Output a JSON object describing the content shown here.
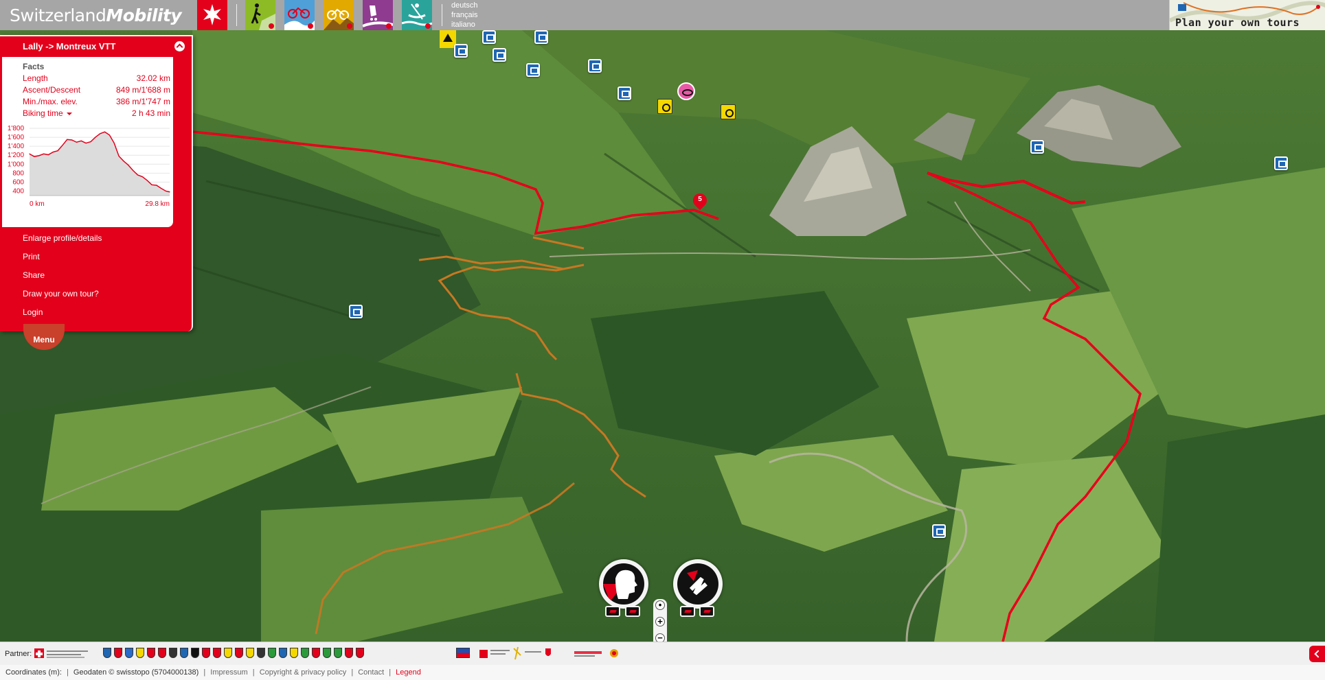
{
  "header": {
    "logo_regular": "Switzerland",
    "logo_bold": "Mobility",
    "languages": [
      "deutsch",
      "français",
      "italiano"
    ],
    "plan_tours_label": "Plan your own tours",
    "activities": [
      {
        "icon": "hiking-icon",
        "color": "#8dbb25"
      },
      {
        "icon": "cycling-icon",
        "color": "#4fa0d8"
      },
      {
        "icon": "mountainbike-icon",
        "color": "#e2a900"
      },
      {
        "icon": "skating-icon",
        "color": "#8f3b8f"
      },
      {
        "icon": "canoeing-icon",
        "color": "#2aa39b"
      }
    ]
  },
  "route_panel": {
    "title": "Lally -> Montreux VTT",
    "facts_heading": "Facts",
    "facts": [
      {
        "label": "Length",
        "value": "32.02 km"
      },
      {
        "label": "Ascent/Descent",
        "value": "849 m/1'688 m"
      },
      {
        "label": "Min./max. elev.",
        "value": "386 m/1'747 m"
      },
      {
        "label": "Biking time",
        "value": "2 h 43 min"
      }
    ],
    "menu_links": [
      "Enlarge profile/details",
      "Print",
      "Share",
      "Draw your own tour?",
      "Login"
    ]
  },
  "menu_button": "Menu",
  "stage_marker": "5",
  "chart_data": {
    "type": "area",
    "title": "",
    "xlabel": "",
    "ylabel": "",
    "x_tick_labels": [
      "0 km",
      "29.8 km"
    ],
    "y_tick_labels": [
      "1'800",
      "1'600",
      "1'400",
      "1'200",
      "1'000",
      "800",
      "600",
      "400"
    ],
    "xlim": [
      0,
      29.8
    ],
    "ylim": [
      300,
      1800
    ],
    "grid": true,
    "x": [
      0,
      1,
      2,
      3,
      4,
      5,
      6,
      7,
      8,
      9,
      10,
      11,
      12,
      13,
      14,
      15,
      16,
      17,
      18,
      19,
      20,
      21,
      22,
      23,
      24,
      25,
      26,
      27,
      28,
      29,
      29.8
    ],
    "values": [
      1230,
      1170,
      1190,
      1230,
      1210,
      1270,
      1300,
      1420,
      1550,
      1540,
      1490,
      1520,
      1470,
      1500,
      1600,
      1680,
      1720,
      1650,
      1470,
      1180,
      1070,
      980,
      860,
      760,
      720,
      640,
      540,
      530,
      460,
      400,
      380
    ],
    "line_color": "#e3001b",
    "fill_color": "#dcdcdc"
  },
  "footer": {
    "partner_label": "Partner:",
    "coordinates_label": "Coordinates (m):",
    "geodata": "Geodaten © swisstopo (5704000138)",
    "links": [
      "Impressum",
      "Copyright & privacy policy",
      "Contact"
    ],
    "legend": "Legend"
  },
  "colors": {
    "brand_red": "#e3001b",
    "header_grey": "#a6a6a6",
    "route_red": "#e8001b",
    "alt_route_orange": "#c87822"
  }
}
